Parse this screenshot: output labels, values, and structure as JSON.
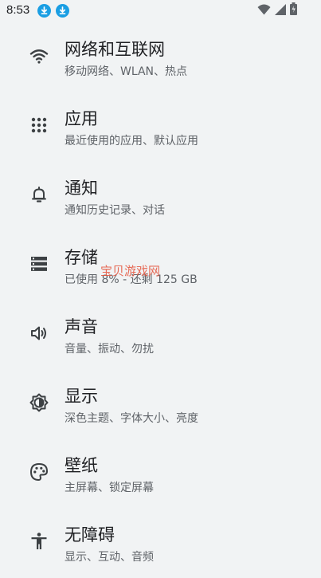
{
  "status_bar": {
    "time": "8:53",
    "notification_icons": [
      "download-icon",
      "download-icon"
    ],
    "system_icons": [
      "wifi-icon",
      "cell-signal-icon",
      "battery-icon"
    ],
    "accent_color": "#1a9ee3"
  },
  "settings": [
    {
      "icon": "wifi-icon",
      "title": "网络和互联网",
      "subtitle": "移动网络、WLAN、热点"
    },
    {
      "icon": "apps-grid-icon",
      "title": "应用",
      "subtitle": "最近使用的应用、默认应用"
    },
    {
      "icon": "bell-icon",
      "title": "通知",
      "subtitle": "通知历史记录、对话"
    },
    {
      "icon": "storage-icon",
      "title": "存储",
      "subtitle": "已使用 8% - 还剩 125 GB"
    },
    {
      "icon": "volume-icon",
      "title": "声音",
      "subtitle": "音量、振动、勿扰"
    },
    {
      "icon": "brightness-icon",
      "title": "显示",
      "subtitle": "深色主题、字体大小、亮度"
    },
    {
      "icon": "palette-icon",
      "title": "壁纸",
      "subtitle": "主屏幕、锁定屏幕"
    },
    {
      "icon": "accessibility-icon",
      "title": "无障碍",
      "subtitle": "显示、互动、音频"
    }
  ],
  "watermark": "宝贝游戏网"
}
